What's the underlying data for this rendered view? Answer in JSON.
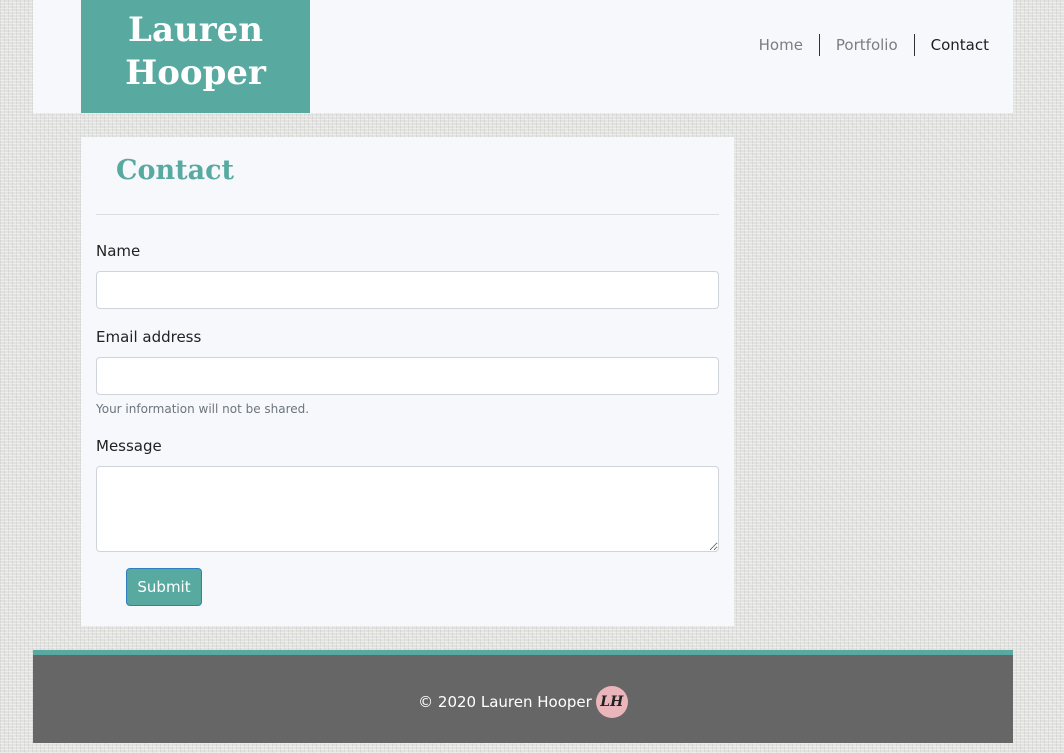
{
  "header": {
    "brand_line1": "Lauren",
    "brand_line2": "Hooper",
    "nav": [
      {
        "label": "Home"
      },
      {
        "label": "Portfolio"
      },
      {
        "label": "Contact"
      }
    ],
    "active_nav": "Contact"
  },
  "contact": {
    "title": "Contact",
    "name_label": "Name",
    "name_value": "",
    "email_label": "Email address",
    "email_value": "",
    "email_help": "Your information will not be shared.",
    "message_label": "Message",
    "message_value": "",
    "submit_label": "Submit"
  },
  "footer": {
    "copyright": "© 2020 Lauren Hooper",
    "logo_text": "LH"
  },
  "colors": {
    "accent": "#58aaa1",
    "panel": "#f7f8fc",
    "footer": "#666666",
    "logo_badge": "#eab6bb"
  }
}
